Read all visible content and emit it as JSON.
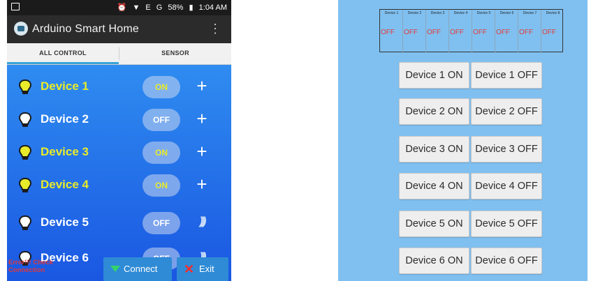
{
  "phone": {
    "status_bar": {
      "battery": "58%",
      "time": "1:04 AM",
      "network": "E",
      "network2": "G"
    },
    "app_title": "Arduino Smart Home",
    "tabs": [
      {
        "label": "ALL CONTROL",
        "active": true
      },
      {
        "label": "SENSOR",
        "active": false
      }
    ],
    "devices": [
      {
        "name": "Device 1",
        "state": "ON",
        "action_icon": "plus"
      },
      {
        "name": "Device 2",
        "state": "OFF",
        "action_icon": "plus"
      },
      {
        "name": "Device 3",
        "state": "ON",
        "action_icon": "plus"
      },
      {
        "name": "Device 4",
        "state": "ON",
        "action_icon": "plus"
      },
      {
        "name": "Device 5",
        "state": "OFF",
        "action_icon": "wave"
      },
      {
        "name": "Device 6",
        "state": "OFF",
        "action_icon": "wave"
      }
    ],
    "error_text": "Error!!! Check Connection",
    "connect_label": "Connect",
    "exit_label": "Exit",
    "colors": {
      "on_text": "#e7eb2a",
      "off_text": "#ffffff",
      "panel_top": "#2f8cf0",
      "panel_bottom": "#1a57e2",
      "error": "#e0383d"
    }
  },
  "web": {
    "status_table": {
      "headers": [
        "Device 1",
        "Device 2",
        "Device 3",
        "Device 4",
        "Device 5",
        "Device 6",
        "Device 7",
        "Device 8"
      ],
      "values": [
        "OFF",
        "OFF",
        "OFF",
        "OFF",
        "OFF",
        "OFF",
        "OFF",
        "OFF"
      ]
    },
    "buttons": [
      {
        "on": "Device 1 ON",
        "off": "Device 1 OFF"
      },
      {
        "on": "Device 2 ON",
        "off": "Device 2 OFF"
      },
      {
        "on": "Device 3 ON",
        "off": "Device 3 OFF"
      },
      {
        "on": "Device 4 ON",
        "off": "Device 4 OFF"
      },
      {
        "on": "Device 5 ON",
        "off": "Device 5 OFF"
      },
      {
        "on": "Device 6 ON",
        "off": "Device 6 OFF"
      }
    ],
    "colors": {
      "background": "#80c0f0",
      "off_text": "#e23a38"
    }
  }
}
